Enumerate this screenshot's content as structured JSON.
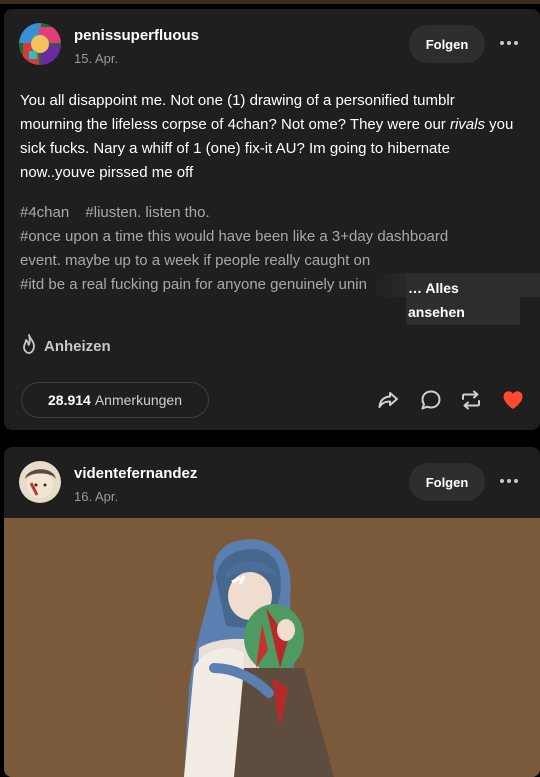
{
  "posts": [
    {
      "username": "penissuperfluous",
      "date": "15. Apr.",
      "follow_label": "Folgen",
      "body_before": "You all disappoint me. Not one (1) drawing of a personified tumblr mourning the lifeless corpse of 4chan? Not ome? They were our ",
      "body_italic": "rivals",
      "body_after": " you sick fucks. Nary a whiff of 1 (one) fix-it AU? Im going to hibernate now..youve pirssed me off",
      "tags_line1": [
        "#4chan",
        "#liusten. listen tho."
      ],
      "tags_line2": "#once upon a time this would have been like a 3+day dashboard",
      "tags_line3": "event. maybe up to a week if people really caught on",
      "tags_line4": "#itd be a real fucking pain for anyone genuinely unin",
      "see_all_label": "… Alles ansehen",
      "heat_label": "Anheizen",
      "notes_count": "28.914",
      "notes_label": "Anmerkungen"
    },
    {
      "username": "videntefernandez",
      "date": "16. Apr.",
      "follow_label": "Folgen"
    }
  ],
  "icons": {
    "more": "more-horizontal-icon",
    "heat": "flame-icon",
    "share": "share-arrow-icon",
    "reply": "speech-bubble-icon",
    "reblog": "reblog-icon",
    "like": "heart-icon"
  },
  "colors": {
    "like_active": "#ff4930",
    "card_bg": "#1f1f1f",
    "page_bg": "#000000",
    "art_bg": "#7a5a3a"
  }
}
